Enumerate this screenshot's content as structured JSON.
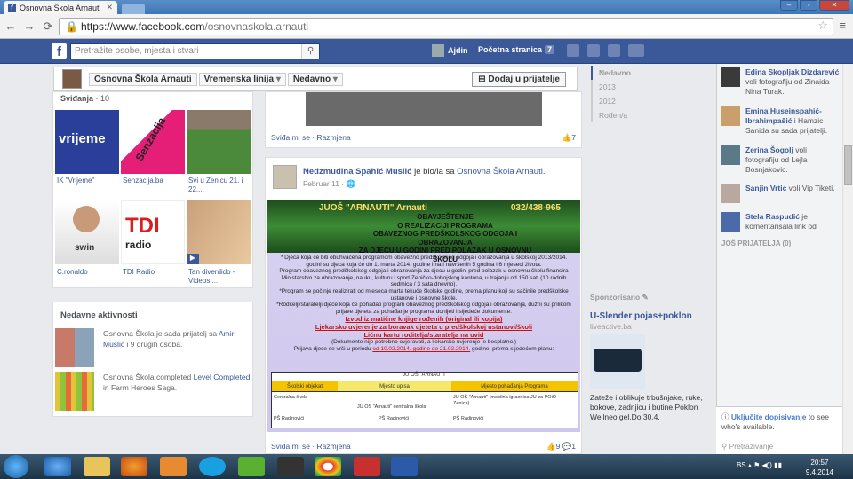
{
  "browser": {
    "tab_title": "Osnovna Škola Arnauti",
    "url_host": "https://www.facebook.com",
    "url_path": "/osnovnaskola.arnauti"
  },
  "fb": {
    "search_placeholder": "Pretražite osobe, mjesta i stvari",
    "user_name": "Ajdin",
    "home_label": "Početna stranica",
    "home_count": "7"
  },
  "header": {
    "page_name": "Osnovna Škola Arnauti",
    "timeline_label": "Vremenska linija",
    "recent_label": "Nedavno",
    "add_friend": "Dodaj u prijatelje"
  },
  "likes": {
    "title": "Sviđanja",
    "count": "10",
    "items": [
      {
        "label": "IK \"Vrijeme\""
      },
      {
        "label": "Senzacija.ba"
      },
      {
        "label": "Svi u Zenicu 21. i 22...."
      },
      {
        "label": "C.ronaldo"
      },
      {
        "label": "TDI Radio"
      },
      {
        "label": "Tan diverdido - Videos...."
      }
    ],
    "pic_text": {
      "vrijeme": "vrijeme",
      "senzacija": "Senzacija",
      "tdi": "TDI",
      "tdi_sub": "radio",
      "swin": "swin"
    }
  },
  "activity": {
    "title": "Nedavne aktivnosti",
    "rows": [
      {
        "pre": "Osnovna Škola je sada prijatelj sa ",
        "link": "Amir Muslic",
        "post": " i 9 drugih osoba."
      },
      {
        "pre": "Osnovna Škola completed ",
        "link": "Level Completed",
        "post": " in Farm Heroes Saga."
      }
    ]
  },
  "post1": {
    "footer": "Sviđa mi se · Razmjena",
    "likes": "7"
  },
  "post2": {
    "author": "Nedzmudina Spahić Muslić",
    "action": " je bio/la sa ",
    "target": "Osnovna Škola Arnauti.",
    "date": "Februar 11 · ",
    "footer": "Sviđa mi se · Razmjena",
    "likes": "9",
    "comments": "1",
    "poster": {
      "school": "JUOŠ \"ARNAUTI\" Arnauti",
      "phone": "032/438-965",
      "obav1": "OBAVJEŠTENJE",
      "obav2": "O REALIZACIJI PROGRAMA",
      "obav3": "OBAVEZNOG PREDŠKOLSKOG ODGOJA I OBRAZOVANJA",
      "obav4": "ZA DJECU U GODINI PRED POLAZAK U OSNOVNU ŠKOLU",
      "b1": "* Djeca koja će biti obuhvaćena programom obavezno predškolskog odgoja i obrazovanja u školskoj 2013/2014. godini su djeca koja će do 1. marta 2014. godine imati navršenih 5 godina i 6 mjeseci života.",
      "b2": "Program obaveznog predškolskog odgoja i obrazovanja za djecu u godini pred polazak u osnovnu školu finansira Ministarstvo za obrazovanje, nauku, kulturu i sport Zeničko-dobojskog kantona, u trajanju od 150 sati (10 radnih sedmica / 3 sata dnevno).",
      "b3": "*Program se počinje realizirati od mjeseca marta tekuće školske godine, prema planu koji su sačinile predškolske ustanove i osnovne škole.",
      "b4": "*Roditelji/staratelji djece koja će pohađati program obaveznog predškolskog odgoja i obrazovanja, dužni su prilikom prijave djeteta za pohađanje programa donijeti i sljedeće dokumente:",
      "r1": "Izvod iz matične knjige rođenih (original ili kopija)",
      "r2": "Ljekarsko uvjerenje za boravak djeteta u predškolskoj ustanovi/školi",
      "r3": "Ličnu kartu roditelja/staratelja na uvid",
      "b5": "(Dokumente nije potrebno ovjeravati, a ljekarsko uvjerenje je besplatno.)",
      "b6a": "Prijava djece se vrši u periodu ",
      "b6r": "od 10.02.2014. godine do 21.02.2014.",
      "b6b": " godine, prema sljedećem planu:",
      "table_title": "JU OŠ \"ARNAUTI\"",
      "col1": "Školski objekat",
      "col2": "Mjesto upisa",
      "col3": "Mjesto pohađanja Programa",
      "c11": "Centralna škola",
      "c12": "JU OŠ \"Arnauti\" centralna škola",
      "c13": "JU OŠ \"Arnauti\" (mobilna igraonica JU za POiO Zenica)",
      "c21": "PŠ Radinovići",
      "c22": "PŠ Radinovići",
      "c23": "PŠ Radinovići"
    }
  },
  "timeline_years": [
    "Nedavno",
    "2013",
    "2012",
    "Rođen/a"
  ],
  "sponsored": {
    "title": "Sponzorisano",
    "ad_title": "U-Slender pojas+poklon",
    "ad_url": "liveactive.ba",
    "ad_text": "Zateže i oblikuje trbušnjake, ruke, bokove, zadnjicu i butine.Poklon Wellneo gel.Do 30.4."
  },
  "ticker": [
    {
      "name": "Edina Skopljak Dizdarević",
      "text": " voli fotografiju od Zinaida Nina Turak."
    },
    {
      "name": "Emina Huseinspahić-Ibrahimpašić",
      "text": " i Hamzic Sanida su sada prijatelji."
    },
    {
      "name": "Zerina Šogolj",
      "text": " voli fotografiju od Lejla Bosnjakovic."
    },
    {
      "name": "Sanjin Vrtic",
      "text": " voli Vip Tiketi."
    },
    {
      "name": "Stela Raspudić",
      "text": " je komentarisala link od"
    }
  ],
  "friends_more": "JOŠ PRIJATELJA (0)",
  "chat": {
    "warn_link": "Uključite dopisivanje",
    "warn_text": " to see who's available.",
    "search": "Pretraživanje"
  },
  "taskbar": {
    "lang": "BS",
    "time": "20:57",
    "date": "9.4.2014"
  }
}
